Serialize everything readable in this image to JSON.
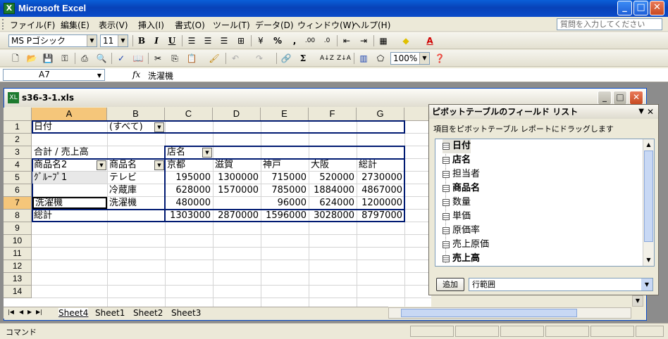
{
  "window": {
    "title": "Microsoft Excel",
    "app_icon": "X"
  },
  "menu": {
    "items": [
      "ファイル(F)",
      "編集(E)",
      "表示(V)",
      "挿入(I)",
      "書式(O)",
      "ツール(T)",
      "データ(D)",
      "ウィンドウ(W)",
      "ヘルプ(H)"
    ],
    "help_placeholder": "質問を入力してください"
  },
  "format_toolbar": {
    "font": "MS Pゴシック",
    "size": "11",
    "bold": "B",
    "italic": "I",
    "underline": "U",
    "percent": "%",
    "comma": ",",
    "inc_dec": ".00",
    "dec_dec": ".0"
  },
  "standard_toolbar": {
    "zoom": "100%",
    "sigma": "Σ"
  },
  "formula_bar": {
    "cell_ref": "A7",
    "fx": "fx",
    "content": "洗濯機"
  },
  "document": {
    "title": "s36-3-1.xls"
  },
  "sheet": {
    "columns": [
      "A",
      "B",
      "C",
      "D",
      "E",
      "F",
      "G"
    ],
    "active_column": "A",
    "active_row": "7",
    "rows": [
      "1",
      "2",
      "3",
      "4",
      "5",
      "6",
      "7",
      "8",
      "9",
      "10",
      "11",
      "12",
      "13",
      "14"
    ],
    "cells": {
      "a1": "日付",
      "b1": "(すべて)",
      "a3": "合計 / 売上高",
      "c3": "店名",
      "a4": "商品名2",
      "b4": "商品名",
      "c4": "京都",
      "d4": "滋賀",
      "e4": "神戸",
      "f4": "大阪",
      "g4": "総計",
      "a5": "ｸﾞﾙｰﾌﾟ1",
      "b5": "テレビ",
      "c5": "195000",
      "d5": "1300000",
      "e5": "715000",
      "f5": "520000",
      "g5": "2730000",
      "b6": "冷蔵庫",
      "c6": "628000",
      "d6": "1570000",
      "e6": "785000",
      "f6": "1884000",
      "g6": "4867000",
      "a7": "洗濯機",
      "b7": "洗濯機",
      "c7": "480000",
      "e7": "96000",
      "f7": "624000",
      "g7": "1200000",
      "a8": "総計",
      "c8": "1303000",
      "d8": "2870000",
      "e8": "1596000",
      "f8": "3028000",
      "g8": "8797000"
    }
  },
  "tabs": [
    "Sheet4",
    "Sheet1",
    "Sheet2",
    "Sheet3"
  ],
  "pivot_field_list": {
    "title": "ピボットテーブルのフィールド リスト",
    "instruction": "項目をピボットテーブル レポートにドラッグします",
    "fields": [
      {
        "label": "日付",
        "bold": true
      },
      {
        "label": "店名",
        "bold": true
      },
      {
        "label": "担当者",
        "bold": false
      },
      {
        "label": "商品名",
        "bold": true
      },
      {
        "label": "数量",
        "bold": false
      },
      {
        "label": "単価",
        "bold": false
      },
      {
        "label": "原価率",
        "bold": false
      },
      {
        "label": "売上原価",
        "bold": false
      },
      {
        "label": "売上高",
        "bold": true
      }
    ],
    "add_button": "追加",
    "area": "行範囲"
  },
  "status": {
    "mode": "コマンド"
  }
}
